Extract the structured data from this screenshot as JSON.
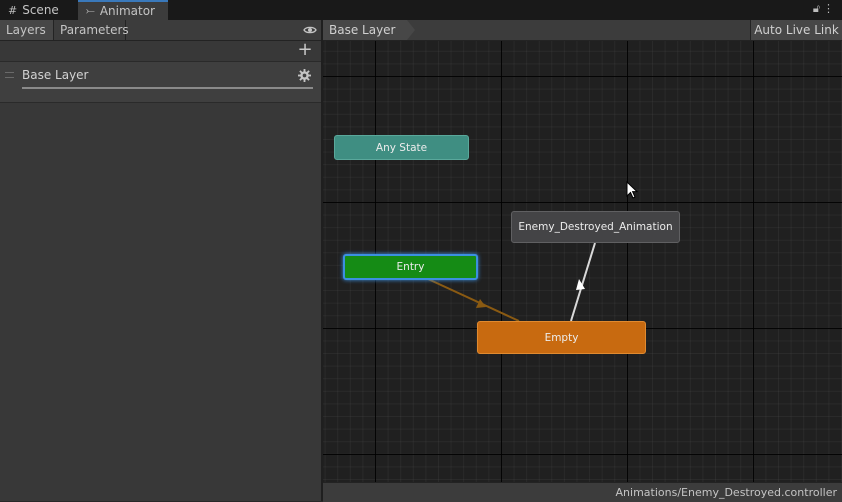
{
  "tabs": [
    {
      "label": "Scene",
      "icon": "grid-icon"
    },
    {
      "label": "Animator",
      "icon": "animator-icon"
    }
  ],
  "left_panel": {
    "layers_label": "Layers",
    "parameters_label": "Parameters",
    "layer_name": "Base Layer"
  },
  "graph_header": {
    "breadcrumb": "Base Layer",
    "auto_live_link_label": "Auto Live Link"
  },
  "states": {
    "any_state": "Any State",
    "entry": "Entry",
    "enemy_destroyed": "Enemy_Destroyed_Animation",
    "empty": "Empty"
  },
  "status": {
    "path": "Animations/Enemy_Destroyed.controller"
  },
  "colors": {
    "any_state": "#3f8e82",
    "entry": "#158b15",
    "default_state": "#c86a10",
    "state": "#444446",
    "selection": "#3c8fe0"
  }
}
